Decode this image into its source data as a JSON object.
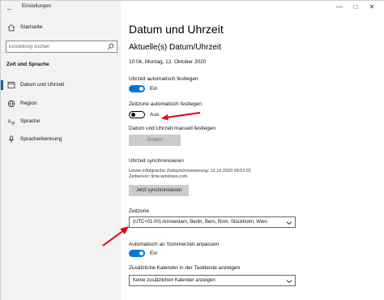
{
  "app": {
    "title": "Einstellungen"
  },
  "sidebar": {
    "home_label": "Startseite",
    "search_placeholder": "Einstellung suchen",
    "section_header": "Zeit und Sprache",
    "items": [
      {
        "label": "Datum und Uhrzeit",
        "icon": "clock-icon",
        "active": true
      },
      {
        "label": "Region",
        "icon": "globe-icon",
        "active": false
      },
      {
        "label": "Sprache",
        "icon": "language-icon",
        "active": false
      },
      {
        "label": "Spracherkennung",
        "icon": "microphone-icon",
        "active": false
      }
    ]
  },
  "main": {
    "title": "Datum und Uhrzeit",
    "subheading": "Aktuelle(s) Datum/Uhrzeit",
    "current_datetime": "10:06, Montag, 12. Oktober 2020",
    "auto_time": {
      "label": "Uhrzeit automatisch festlegen",
      "state": "Ein",
      "on": true
    },
    "auto_timezone": {
      "label": "Zeitzone automatisch festlegen",
      "state": "Aus",
      "on": false
    },
    "manual": {
      "label": "Datum und Uhrzeit manuell festlegen",
      "button": "Ändern"
    },
    "sync": {
      "label": "Uhrzeit synchronisieren",
      "last_sync": "Letzte erfolgreiche Zeitsynchronisierung: 12.10.2020 09:51:01",
      "server": "Zeitserver: time.windows.com",
      "button": "Jetzt synchronisieren"
    },
    "timezone": {
      "label": "Zeitzone",
      "value": "(UTC+01:00) Amsterdam, Berlin, Bern, Rom, Stockholm, Wien"
    },
    "dst": {
      "label": "Automatisch an Sommerzeit anpassen",
      "state": "Ein",
      "on": true
    },
    "calendars": {
      "label": "Zusätzliche Kalender in der Taskleiste anzeigen",
      "value": "Keine zusätzlichen Kalender anzeigen"
    }
  },
  "colors": {
    "accent": "#0078d7",
    "sidebar_bg": "#f2f2f2",
    "annotation_arrow": "#e3001b"
  }
}
